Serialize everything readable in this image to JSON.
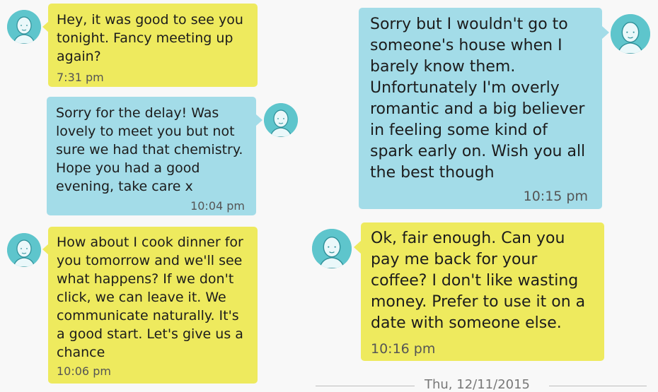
{
  "colors": {
    "incoming_bubble": "#eeea5e",
    "outgoing_bubble": "#a3dce8",
    "avatar_bg": "#5ec5cc"
  },
  "icons": {
    "avatar": "default-contact-avatar-icon"
  },
  "left_column": {
    "messages": [
      {
        "direction": "incoming",
        "text": "Hey, it was good to see you\ntonight. Fancy meeting up\nagain?",
        "time": "7:31 pm"
      },
      {
        "direction": "outgoing",
        "text": "Sorry for the delay! Was\nlovely to meet you but not\nsure we had that chemistry.\nHope you had a good\nevening, take care x",
        "time": "10:04 pm"
      },
      {
        "direction": "incoming",
        "text": "How about I cook dinner for\nyou tomorrow and we'll see\nwhat happens? If we don't\nclick, we can leave it. We\ncommunicate naturally. It's\na good start. Let's give us a\nchance",
        "time": "10:06 pm"
      }
    ]
  },
  "right_column": {
    "messages": [
      {
        "direction": "outgoing",
        "text": "Sorry but I wouldn't go to\nsomeone's house when I\nbarely know them.\nUnfortunately I'm overly\nromantic and a big believer\nin feeling some kind of\nspark early on. Wish you all\nthe best though",
        "time": "10:15 pm"
      },
      {
        "direction": "incoming",
        "text": "Ok, fair enough. Can you\npay me back for your\ncoffee? I don't like wasting\nmoney. Prefer to use it on a\ndate with someone else.",
        "time": "10:16 pm"
      }
    ],
    "date_divider": "Thu, 12/11/2015"
  }
}
